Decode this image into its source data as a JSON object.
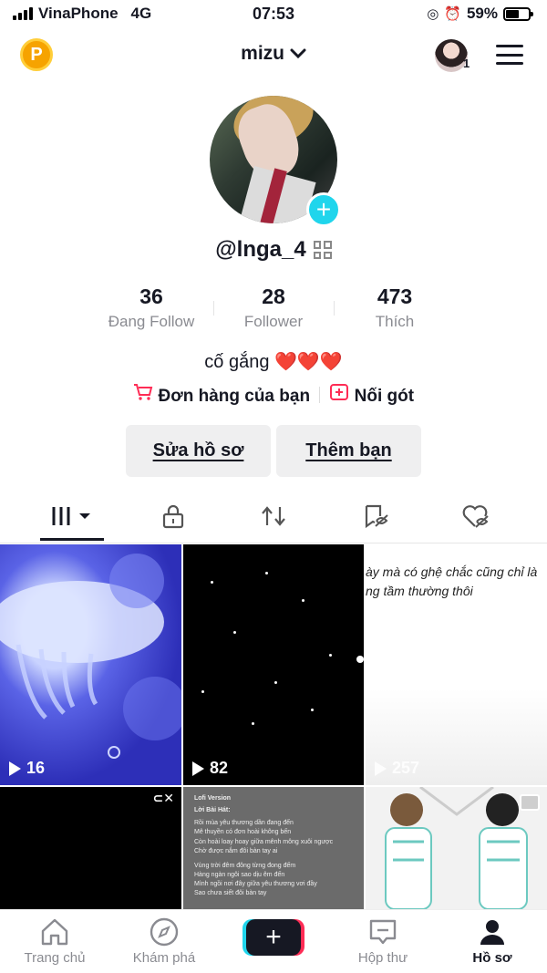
{
  "status_bar": {
    "carrier": "VinaPhone",
    "network": "4G",
    "time": "07:53",
    "battery": "59%",
    "battery_level": 0.59
  },
  "header": {
    "coin_letter": "P",
    "username": "mizu",
    "avatar_badge_count": "1"
  },
  "profile": {
    "handle": "@lnga_4",
    "stats": [
      {
        "value": "36",
        "label": "Đang Follow"
      },
      {
        "value": "28",
        "label": "Follower"
      },
      {
        "value": "473",
        "label": "Thích"
      }
    ],
    "bio_text": "cố gắng",
    "bio_emoji": "❤️❤️❤️",
    "orders_link": "Đơn hàng của bạn",
    "extra_link": "Nối gót",
    "edit_button": "Sửa hồ sơ",
    "add_friend_button": "Thêm bạn"
  },
  "tabs": [
    "videos-icon",
    "private-lock-icon",
    "repost-icon",
    "favorites-icon",
    "liked-icon"
  ],
  "videos": [
    {
      "views": "16"
    },
    {
      "views": "82"
    },
    {
      "views": "257",
      "caption_line1": "ày mà có ghệ chắc cũng chỉ là",
      "caption_line2": "ng tầm thường thôi"
    },
    {},
    {
      "lyric_title": "Lofi Version",
      "lyric_sub": "Lời Bài Hát:",
      "lyric_lines": [
        "Rồi mùa yêu thương dần đang đến",
        "Mê thuyền có đơn hoài không bến",
        "Còn hoài loay hoay giữa mênh mông xuôi ngược",
        "Chờ được nắm đôi bàn tay ai",
        "",
        "Vùng trời đêm đông từng đong đếm",
        "Hàng ngàn ngôi sao dịu êm đến",
        "Mình ngồi nơi đây giữa yêu thương vơi đầy",
        "Sao chưa siết đôi bàn tay"
      ]
    },
    {}
  ],
  "nav": [
    {
      "label": "Trang chủ"
    },
    {
      "label": "Khám phá"
    },
    {
      "label": "Hộp thư"
    },
    {
      "label": "Hồ sơ"
    }
  ]
}
